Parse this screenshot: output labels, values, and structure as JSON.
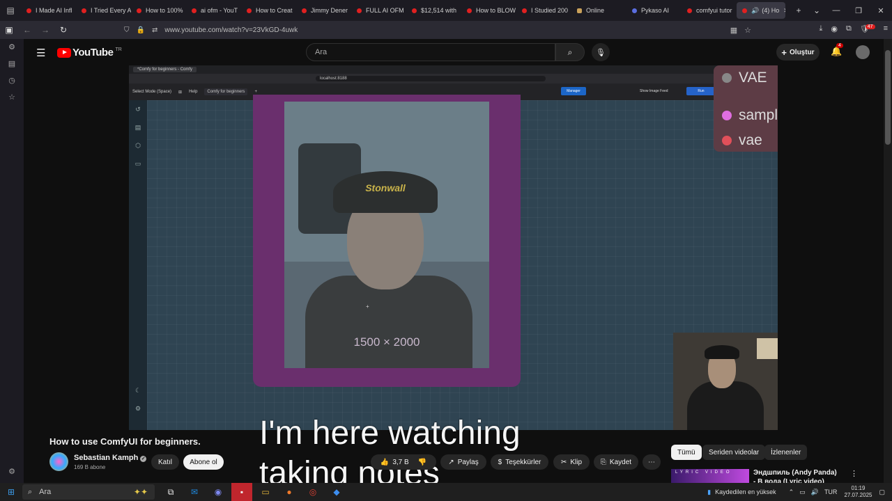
{
  "browser": {
    "tabs": [
      {
        "label": "I Made AI Infl"
      },
      {
        "label": "I Tried Every A"
      },
      {
        "label": "How to 100%"
      },
      {
        "label": "ai ofm - YouT"
      },
      {
        "label": "How to Creat"
      },
      {
        "label": "Jimmy Dener"
      },
      {
        "label": "FULL AI OFM"
      },
      {
        "label": "$12,514 with"
      },
      {
        "label": "How to BLOW"
      },
      {
        "label": "I Studied 200"
      },
      {
        "label": "Online"
      },
      {
        "label": "Pykaso AI"
      },
      {
        "label": "comfyui tutor"
      }
    ],
    "active_tab": {
      "label": "(4) Ho"
    },
    "url": "www.youtube.com/watch?v=23VkGD-4uwk",
    "ext_badge": "47"
  },
  "youtube": {
    "logo_text": "YouTube",
    "country": "TR",
    "search_placeholder": "Ara",
    "create_label": "Oluştur",
    "notif_count": "4"
  },
  "video_frame": {
    "inner_tab": "*Comfy for beginners - Comfy",
    "inner_url": "localhost:8188",
    "menu_select": "Select Mode (Space)",
    "menu_help": "Help",
    "workflow_tab": "Comfy for beginners",
    "manager_label": "Manager",
    "show_image_feed": "Show Image Feed",
    "run_label": "Run",
    "cap_text": "Stonwall",
    "dimensions": "1500 × 2000",
    "vae_title": "VAE",
    "node_outputs": [
      {
        "label": "sampl",
        "color": "#e06ee0"
      },
      {
        "label": "vae",
        "color": "#e0505a"
      }
    ]
  },
  "caption": {
    "line1": "I'm here watching",
    "line2": "taking notes"
  },
  "video_info": {
    "title": "How to use ComfyUI for beginners.",
    "channel": "Sebastian Kamph",
    "subscribers": "169 B abone",
    "join_label": "Katıl",
    "subscribe_label": "Abone ol",
    "likes": "3,7 B",
    "share_label": "Paylaş",
    "thanks_label": "Teşekkürler",
    "clip_label": "Klip",
    "save_label": "Kaydet"
  },
  "recommendations": {
    "chips": [
      {
        "label": "Tümü"
      },
      {
        "label": "Seriden videolar"
      },
      {
        "label": "İzlenenler"
      }
    ],
    "first": {
      "thumb_text": "LYRIC VIDEO",
      "title": "Эндшпиль (Andy Panda) - В вода (Lyric video)"
    }
  },
  "taskbar": {
    "search_placeholder": "Ara",
    "notice": "Kaydedilen en yüksek",
    "language": "TUR",
    "time": "01:19",
    "date": "27.07.2025"
  }
}
